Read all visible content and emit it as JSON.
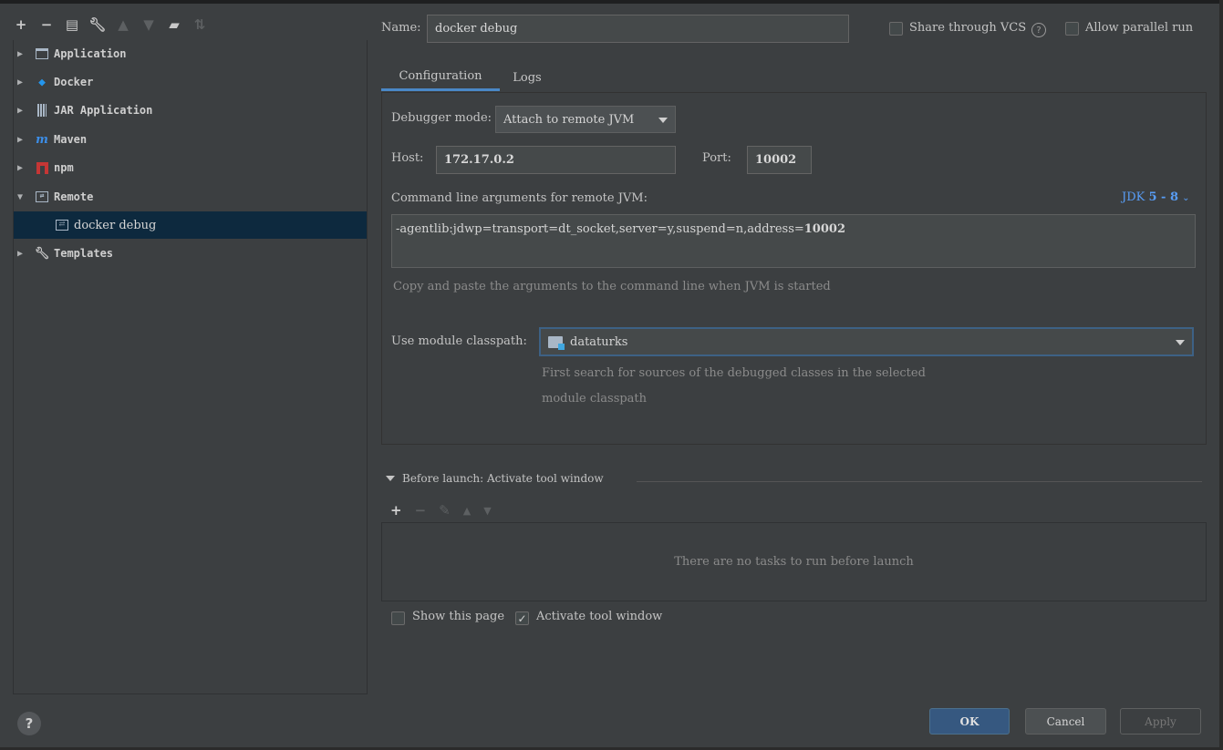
{
  "tree": {
    "items": [
      {
        "label": "Application",
        "icon": "application-icon",
        "expanded": false
      },
      {
        "label": "Docker",
        "icon": "docker-icon",
        "expanded": false
      },
      {
        "label": "JAR Application",
        "icon": "jar-icon",
        "expanded": false
      },
      {
        "label": "Maven",
        "icon": "maven-icon",
        "expanded": false
      },
      {
        "label": "npm",
        "icon": "npm-icon",
        "expanded": false
      },
      {
        "label": "Remote",
        "icon": "remote-icon",
        "expanded": true
      },
      {
        "label": "docker debug",
        "icon": "remote-config-icon",
        "selected": true
      },
      {
        "label": "Templates",
        "icon": "wrench-icon",
        "expanded": false
      }
    ]
  },
  "form": {
    "name_label": "Name:",
    "name_value": "docker debug",
    "share_label": "Share through VCS",
    "share_checked": false,
    "parallel_label": "Allow parallel run",
    "parallel_checked": false
  },
  "tabs": [
    {
      "label": "Configuration",
      "active": true
    },
    {
      "label": "Logs",
      "active": false
    }
  ],
  "config": {
    "debugger_mode_label": "Debugger mode:",
    "debugger_mode_value": "Attach to remote JVM",
    "host_label": "Host:",
    "host_value": "172.17.0.2",
    "port_label": "Port:",
    "port_value": "10002",
    "cmdline_label": "Command line arguments for remote JVM:",
    "jdk_link_prefix": "JDK ",
    "jdk_link_version": "5 - 8",
    "cmdline_value_prefix": "-agentlib:jdwp=transport=dt_socket,server=y,suspend=n,address=",
    "cmdline_value_port": "10002",
    "cmdline_hint": "Copy and paste the arguments to the command line when JVM is started",
    "module_label": "Use module classpath:",
    "module_value": "dataturks",
    "module_hint_line1": "First search for sources of the debugged classes in the selected",
    "module_hint_line2": "module classpath"
  },
  "before_launch": {
    "title": "Before launch: Activate tool window",
    "empty_text": "There are no tasks to run before launch"
  },
  "options": {
    "show_page_label": "Show this page",
    "show_page_checked": false,
    "activate_label": "Activate tool window",
    "activate_checked": true
  },
  "buttons": {
    "ok": "OK",
    "cancel": "Cancel",
    "apply": "Apply"
  },
  "colors": {
    "background": "#3c3f41",
    "selection": "#0d293e",
    "accent": "#4a88c7",
    "link": "#589df6",
    "ok_button": "#365880"
  }
}
